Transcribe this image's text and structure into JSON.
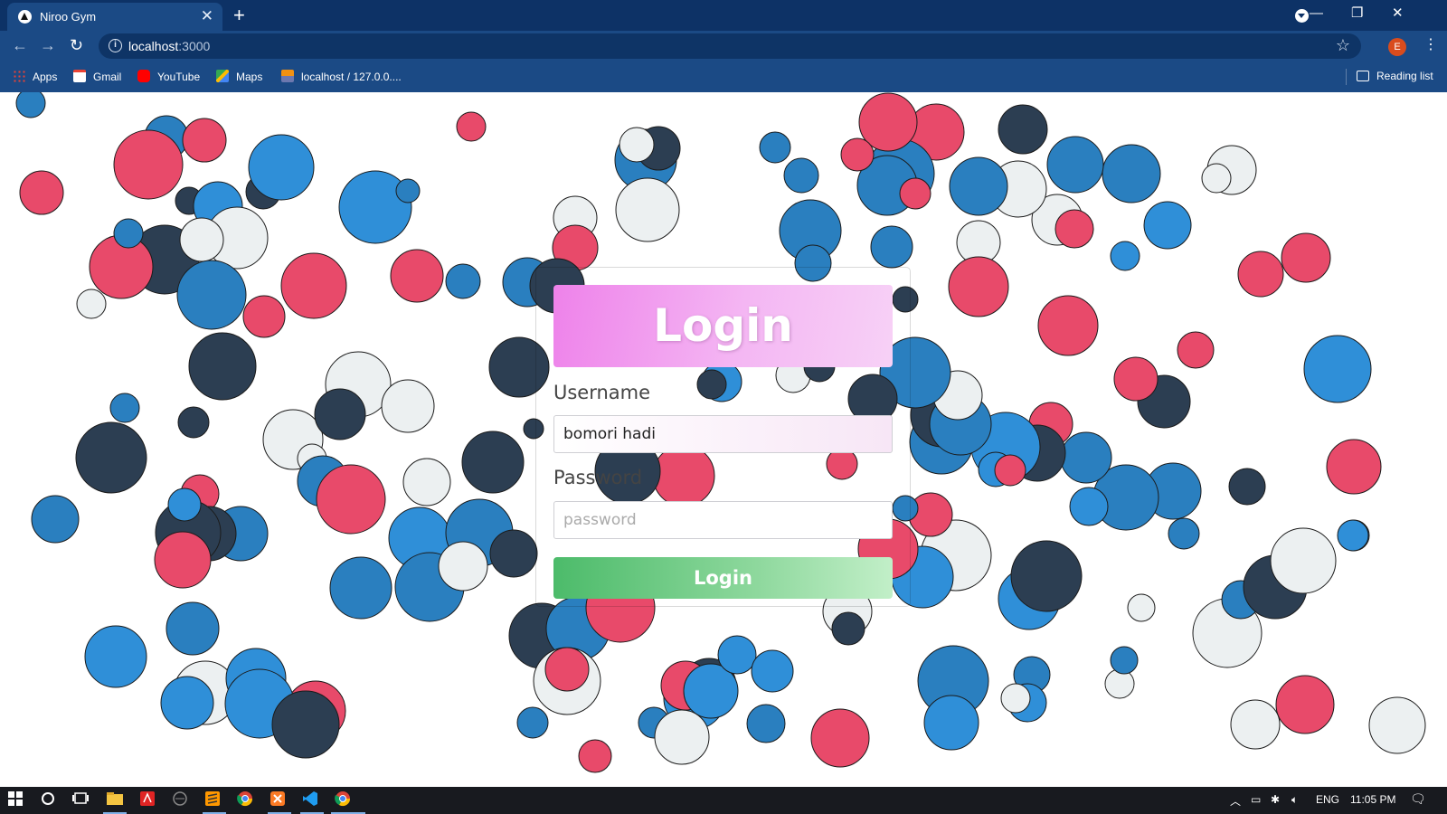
{
  "browser": {
    "tab_title": "Niroo Gym",
    "tab_close": "✕",
    "new_tab": "+",
    "url_host": "localhost",
    "url_port": ":3000",
    "avatar_letter": "E",
    "bookmarks": [
      "Apps",
      "Gmail",
      "YouTube",
      "Maps",
      "localhost / 127.0.0...."
    ],
    "reading_list": "Reading list"
  },
  "login": {
    "title": "Login",
    "username_label": "Username",
    "username_value": "bomori hadi",
    "password_label": "Password",
    "password_placeholder": "password",
    "button_label": "Login"
  },
  "taskbar": {
    "language": "ENG",
    "time": "11:05 PM"
  },
  "colors": {
    "bubble_red": "#e84a6a",
    "bubble_blue": "#2f8fd8",
    "bubble_mid_blue": "#2a7fbf",
    "bubble_dark": "#2c3e52",
    "bubble_white": "#ecf0f1",
    "header_gradient_start": "#ee82ea",
    "button_gradient_start": "#4cbb6a"
  }
}
